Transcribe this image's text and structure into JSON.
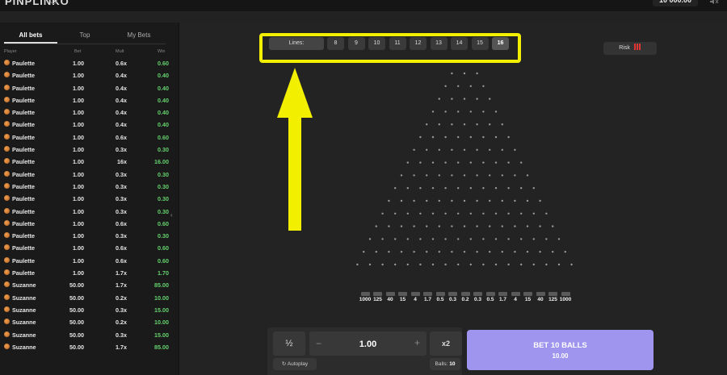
{
  "header": {
    "logo": "PINPLINKO",
    "balance": "10 000.00"
  },
  "bets_panel": {
    "tabs": [
      {
        "label": "All bets",
        "active": true
      },
      {
        "label": "Top",
        "active": false
      },
      {
        "label": "My Bets",
        "active": false
      }
    ],
    "columns": {
      "player": "Player",
      "bet": "Bet",
      "mult": "Mult",
      "win": "Win"
    },
    "rows": [
      {
        "player": "Paulette",
        "bet": "1.00",
        "mult": "0.6x",
        "win": "0.60"
      },
      {
        "player": "Paulette",
        "bet": "1.00",
        "mult": "0.4x",
        "win": "0.40"
      },
      {
        "player": "Paulette",
        "bet": "1.00",
        "mult": "0.4x",
        "win": "0.40"
      },
      {
        "player": "Paulette",
        "bet": "1.00",
        "mult": "0.4x",
        "win": "0.40"
      },
      {
        "player": "Paulette",
        "bet": "1.00",
        "mult": "0.4x",
        "win": "0.40"
      },
      {
        "player": "Paulette",
        "bet": "1.00",
        "mult": "0.4x",
        "win": "0.40"
      },
      {
        "player": "Paulette",
        "bet": "1.00",
        "mult": "0.6x",
        "win": "0.60"
      },
      {
        "player": "Paulette",
        "bet": "1.00",
        "mult": "0.3x",
        "win": "0.30"
      },
      {
        "player": "Paulette",
        "bet": "1.00",
        "mult": "16x",
        "win": "16.00"
      },
      {
        "player": "Paulette",
        "bet": "1.00",
        "mult": "0.3x",
        "win": "0.30"
      },
      {
        "player": "Paulette",
        "bet": "1.00",
        "mult": "0.3x",
        "win": "0.30"
      },
      {
        "player": "Paulette",
        "bet": "1.00",
        "mult": "0.3x",
        "win": "0.30"
      },
      {
        "player": "Paulette",
        "bet": "1.00",
        "mult": "0.3x",
        "win": "0.30"
      },
      {
        "player": "Paulette",
        "bet": "1.00",
        "mult": "0.6x",
        "win": "0.60"
      },
      {
        "player": "Paulette",
        "bet": "1.00",
        "mult": "0.3x",
        "win": "0.30"
      },
      {
        "player": "Paulette",
        "bet": "1.00",
        "mult": "0.6x",
        "win": "0.60"
      },
      {
        "player": "Paulette",
        "bet": "1.00",
        "mult": "0.6x",
        "win": "0.60"
      },
      {
        "player": "Paulette",
        "bet": "1.00",
        "mult": "1.7x",
        "win": "1.70"
      },
      {
        "player": "Suzanne",
        "bet": "50.00",
        "mult": "1.7x",
        "win": "85.00"
      },
      {
        "player": "Suzanne",
        "bet": "50.00",
        "mult": "0.2x",
        "win": "10.00"
      },
      {
        "player": "Suzanne",
        "bet": "50.00",
        "mult": "0.3x",
        "win": "15.00"
      },
      {
        "player": "Suzanne",
        "bet": "50.00",
        "mult": "0.2x",
        "win": "10.00"
      },
      {
        "player": "Suzanne",
        "bet": "50.00",
        "mult": "0.3x",
        "win": "15.00"
      },
      {
        "player": "Suzanne",
        "bet": "50.00",
        "mult": "1.7x",
        "win": "85.00"
      }
    ]
  },
  "lines_selector": {
    "label": "Lines:",
    "options": [
      "8",
      "9",
      "10",
      "11",
      "12",
      "13",
      "14",
      "15",
      "16"
    ],
    "selected": "16"
  },
  "risk": {
    "label": "Risk",
    "level_color": "#e03535"
  },
  "board": {
    "rows": 16,
    "multipliers": [
      "1000",
      "125",
      "40",
      "15",
      "4",
      "1.7",
      "0.5",
      "0.3",
      "0.2",
      "0.3",
      "0.5",
      "1.7",
      "4",
      "15",
      "40",
      "125",
      "1000"
    ]
  },
  "controls": {
    "half_label": "½",
    "minus_label": "−",
    "amount": "1.00",
    "plus_label": "+",
    "double_label": "x2",
    "autoplay_label": "Autoplay",
    "balls_label": "Balls:",
    "balls_value": "10",
    "bet_button_title": "BET 10 BALLS",
    "bet_button_amount": "10.00"
  },
  "colors": {
    "highlight": "#f2ef00",
    "win_green": "#66d36e",
    "bet_button": "#9f94ee"
  }
}
